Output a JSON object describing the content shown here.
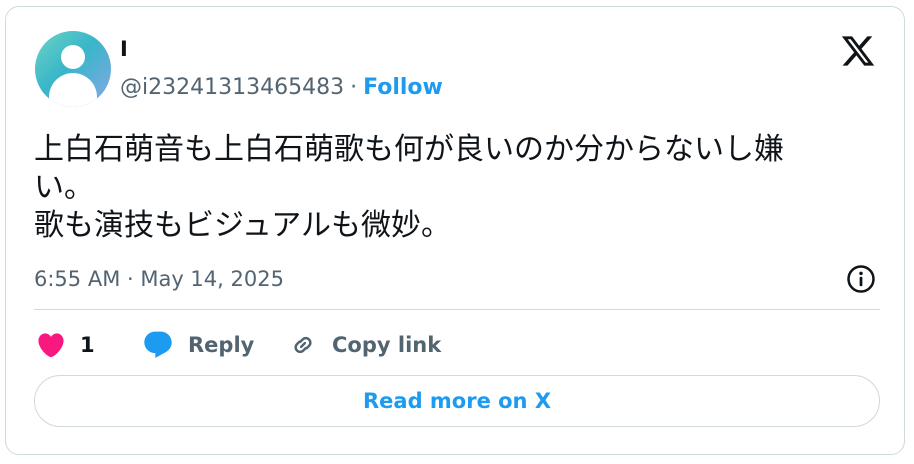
{
  "author": {
    "display_name": "I",
    "handle": "@i23241313465483",
    "separator": "·",
    "follow_label": "Follow"
  },
  "tweet": {
    "text": "上白石萌音も上白石萌歌も何が良いのか分からないし嫌\nい。\n歌も演技もビジュアルも微妙。",
    "timestamp": "6:55 AM · May 14, 2025"
  },
  "actions": {
    "like_count": "1",
    "reply_label": "Reply",
    "copy_link_label": "Copy link"
  },
  "read_more_label": "Read more on X",
  "icons": {
    "logo": "x-logo-icon",
    "info": "info-icon",
    "like": "heart-icon",
    "reply": "speech-bubble-icon",
    "copy": "link-icon"
  },
  "colors": {
    "accent": "#1d9bf0",
    "like": "#f91880",
    "muted_text": "#536471",
    "text": "#0f1419",
    "border": "#cfd9de"
  }
}
